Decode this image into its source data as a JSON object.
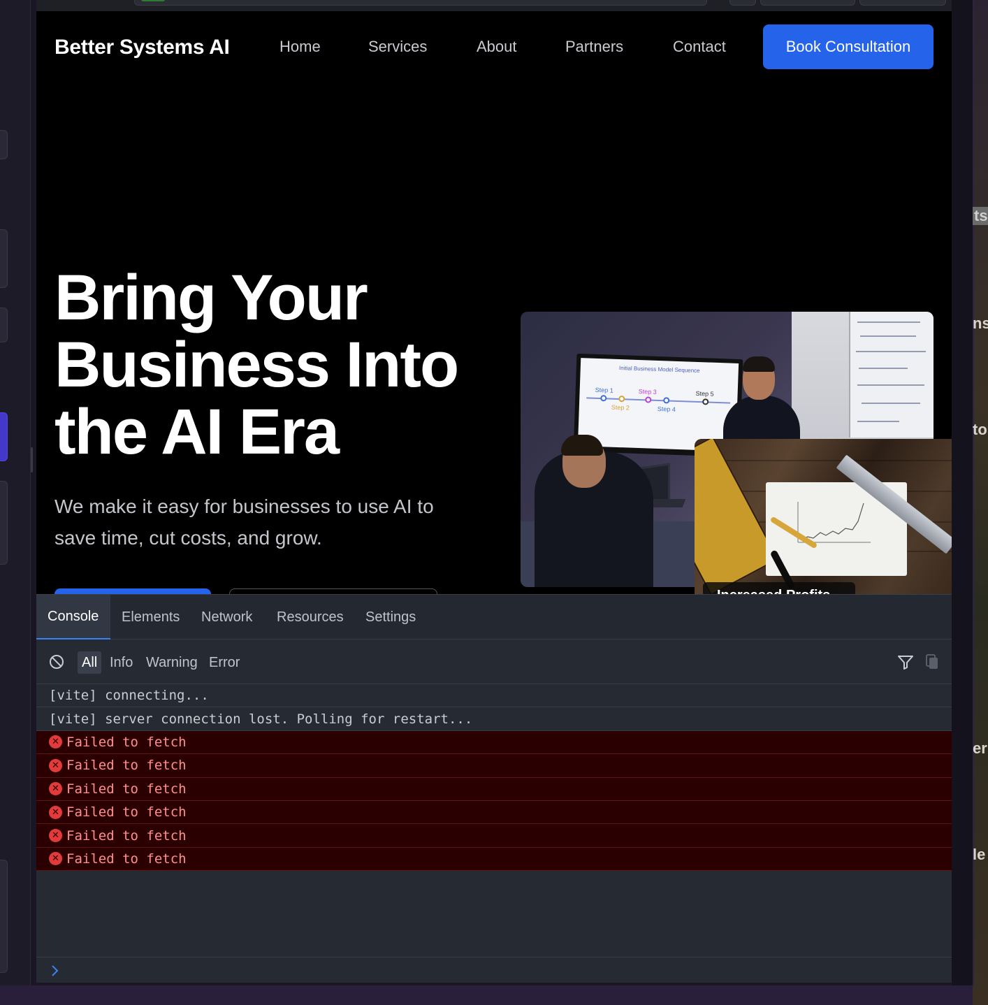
{
  "site": {
    "logo": "Better Systems AI",
    "nav": [
      "Home",
      "Services",
      "About",
      "Partners",
      "Contact"
    ],
    "cta": "Book Consultation",
    "hero_title": "Bring Your Business Into the AI Era",
    "hero_subtitle": "We make it easy for businesses to use AI to save time, cut costs, and grow.",
    "photo_caption": "Increased Profits",
    "photo_screen_title": "Initial Business Model Sequence",
    "photo_screen_steps": [
      "Step 1",
      "Step 2",
      "Step 3",
      "Step 4",
      "Step 5"
    ]
  },
  "devtools": {
    "tabs": [
      "Console",
      "Elements",
      "Network",
      "Resources",
      "Settings"
    ],
    "active_tab": "Console",
    "filters": [
      "All",
      "Info",
      "Warning",
      "Error"
    ],
    "active_filter": "All",
    "logs": [
      {
        "level": "log",
        "text": "[vite] connecting..."
      },
      {
        "level": "log",
        "text": "[vite] server connection lost. Polling for restart..."
      },
      {
        "level": "error",
        "text": "Failed to fetch"
      },
      {
        "level": "error",
        "text": "Failed to fetch"
      },
      {
        "level": "error",
        "text": "Failed to fetch"
      },
      {
        "level": "error",
        "text": "Failed to fetch"
      },
      {
        "level": "error",
        "text": "Failed to fetch"
      },
      {
        "level": "error",
        "text": "Failed to fetch"
      }
    ]
  },
  "background_fragments": [
    "ts",
    "ns",
    "to",
    "er",
    "le"
  ],
  "colors": {
    "accent": "#2563eb",
    "error_bg": "#2a0000",
    "error_text": "#ff8f8f",
    "devtools_bg": "#262a33"
  },
  "icons": [
    "clear-console-icon",
    "filter-funnel-icon",
    "copy-icon",
    "error-icon",
    "console-prompt-icon"
  ]
}
